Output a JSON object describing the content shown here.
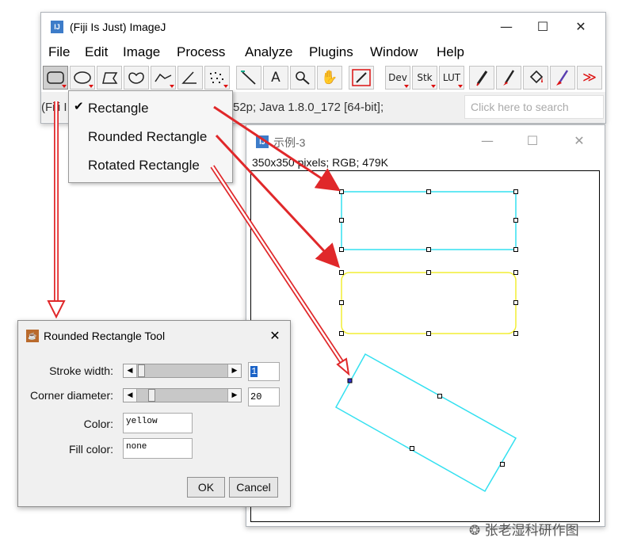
{
  "main_window": {
    "title": "(Fiji Is Just) ImageJ",
    "controls": {
      "minimize": "—",
      "maximize": "☐",
      "close": "✕"
    },
    "menus": [
      "File",
      "Edit",
      "Image",
      "Process",
      "Analyze",
      "Plugins",
      "Window",
      "Help"
    ],
    "toolbar": {
      "dev": "Dev",
      "stk": "Stk",
      "lut": "LUT",
      "more": "≫"
    },
    "status": {
      "prefix": "(Fiji I",
      "text": "52p; Java 1.8.0_172 [64-bit];",
      "search_placeholder": "Click here to search"
    }
  },
  "shape_menu": {
    "items": [
      "Rectangle",
      "Rounded Rectangle",
      "Rotated Rectangle"
    ],
    "checked_index": 0
  },
  "image_window": {
    "title": "示例-3",
    "info": "350x350 pixels; RGB; 479K",
    "controls": {
      "minimize": "—",
      "maximize": "☐",
      "close": "✕"
    }
  },
  "dialog": {
    "title": "Rounded Rectangle Tool",
    "stroke_width_label": "Stroke width:",
    "stroke_width_value": "1",
    "corner_diameter_label": "Corner diameter:",
    "corner_diameter_value": "20",
    "color_label": "Color:",
    "color_value": "yellow",
    "fill_color_label": "Fill color:",
    "fill_color_value": "none",
    "ok_label": "OK",
    "cancel_label": "Cancel",
    "close": "✕"
  },
  "watermark": "张老湿科研作图",
  "colors": {
    "roi_cyan": "#33e0f0",
    "roi_yellow": "#f2ee33",
    "arrow_red": "#e0282a",
    "app_blue": "#3d7cc9"
  }
}
